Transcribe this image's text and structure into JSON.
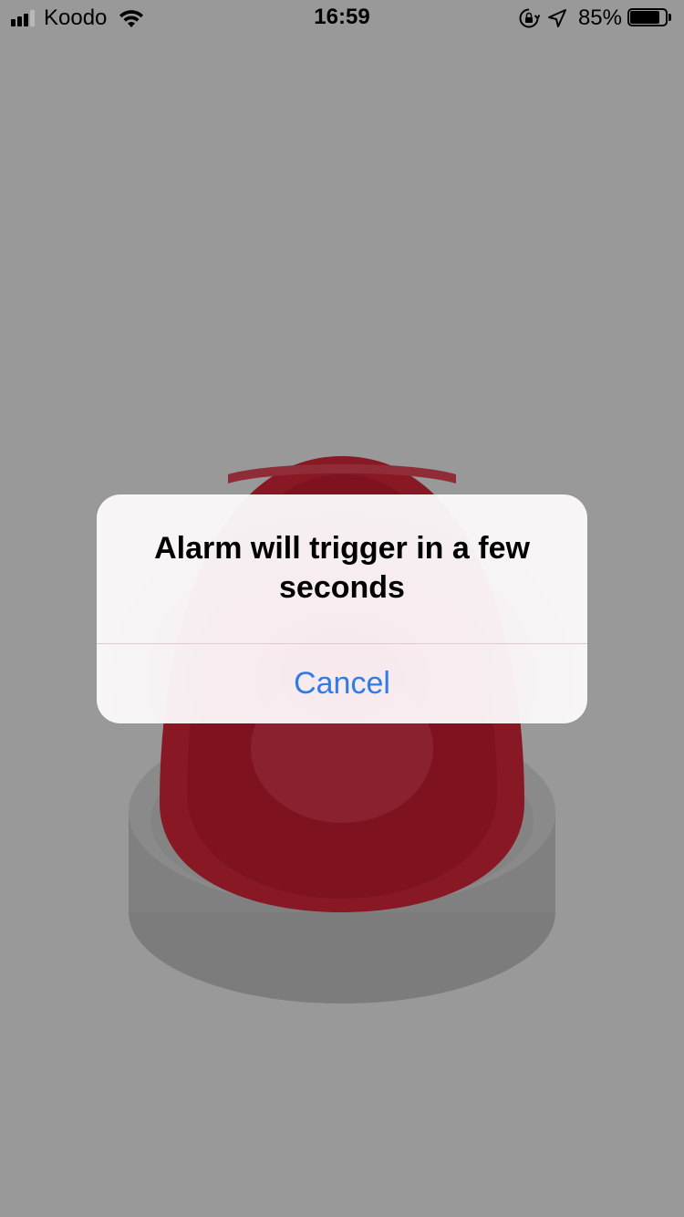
{
  "status_bar": {
    "carrier": "Koodo",
    "time": "16:59",
    "battery_percent": "85%",
    "battery_level": 0.85,
    "signal_bars_active": 3,
    "signal_bars_total": 4,
    "icons": [
      "signal-icon",
      "wifi-icon",
      "rotation-lock-icon",
      "location-arrow-icon",
      "battery-icon"
    ]
  },
  "background": {
    "illustration": "red-alarm-button",
    "dim_overlay": true
  },
  "alert": {
    "message": "Alarm will trigger in a few seconds",
    "cancel_label": "Cancel",
    "accent_color": "#2f7bea"
  },
  "colors": {
    "alarm_red": "#e0233a",
    "base_gray": "#d8d8d8"
  }
}
